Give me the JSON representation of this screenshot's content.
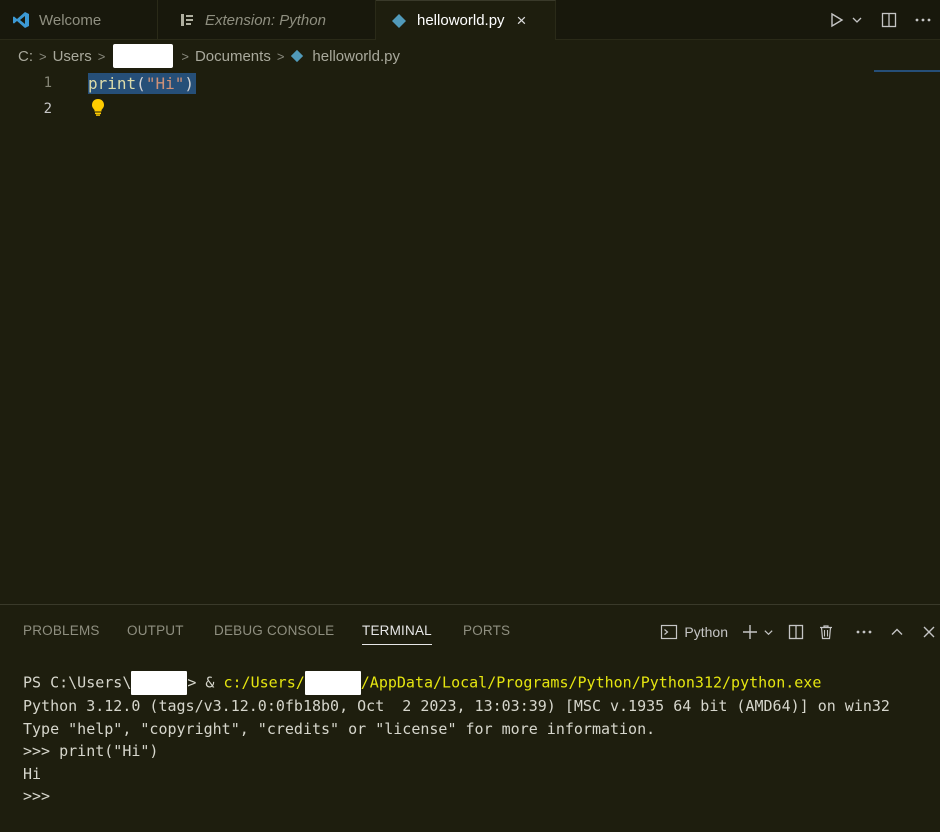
{
  "tabs": {
    "welcome": "Welcome",
    "extension": "Extension: Python",
    "active": "helloworld.py",
    "close": "×"
  },
  "breadcrumb": {
    "drive": "C:",
    "users": "Users",
    "documents": "Documents",
    "file": "helloworld.py"
  },
  "editor": {
    "lines": [
      {
        "num": "1",
        "fn": "print",
        "open": "(",
        "str": "\"Hi\"",
        "close": ")"
      },
      {
        "num": "2"
      }
    ]
  },
  "panel": {
    "tabs": [
      "PROBLEMS",
      "OUTPUT",
      "DEBUG CONSOLE",
      "TERMINAL",
      "PORTS"
    ],
    "terminal_name": "Python"
  },
  "terminal": {
    "line1_prompt": "PS C:\\Users\\",
    "line1_cmd_prefix": "> & ",
    "line1_path_a": "c:/Users/",
    "line1_path_b": "/AppData/Local/Programs/Python/Python312/python.exe",
    "line2": "Python 3.12.0 (tags/v3.12.0:0fb18b0, Oct  2 2023, 13:03:39) [MSC v.1935 64 bit (AMD64)] on win32",
    "line3": "Type \"help\", \"copyright\", \"credits\" or \"license\" for more information.",
    "line4": ">>> print(\"Hi\")",
    "line5": "Hi",
    "line6": ">>>"
  },
  "colors": {
    "background": "#1e1e0e",
    "selection": "#264f78",
    "terminal_path": "#e5e510"
  }
}
